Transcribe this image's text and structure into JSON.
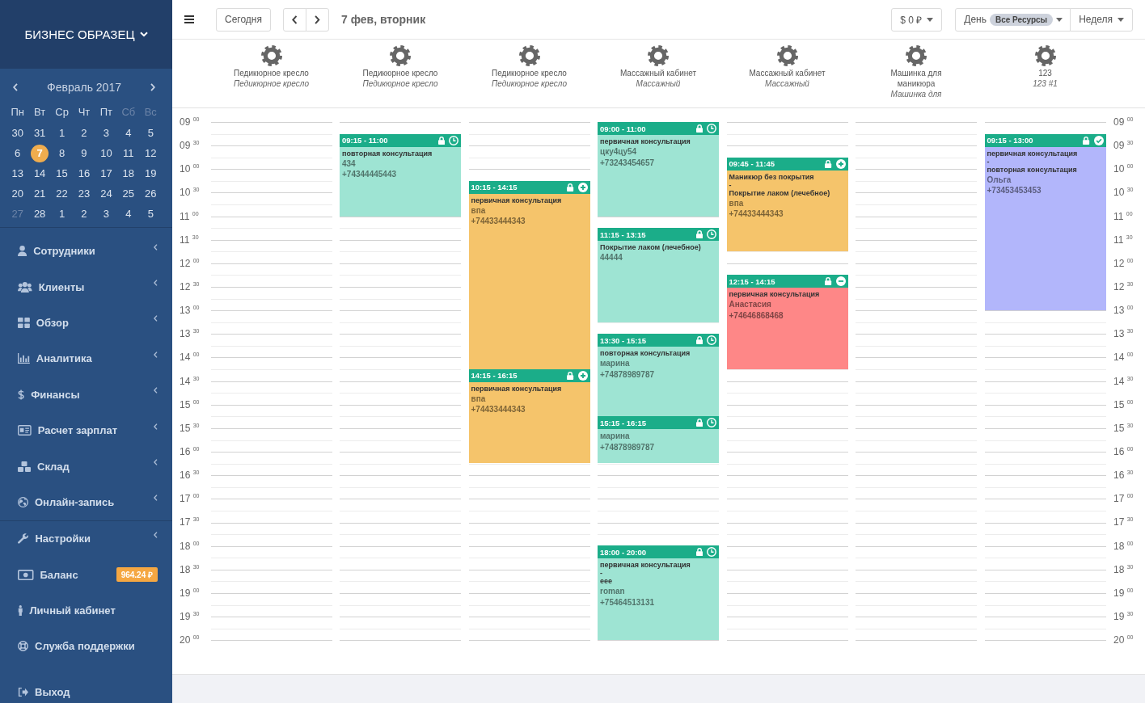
{
  "sidebar": {
    "title": "БИЗНЕС ОБРАЗЕЦ",
    "calendar": {
      "month": "Февраль 2017",
      "weekdays": [
        {
          "label": "Пн",
          "weekend": false
        },
        {
          "label": "Вт",
          "weekend": false
        },
        {
          "label": "Ср",
          "weekend": false
        },
        {
          "label": "Чт",
          "weekend": false
        },
        {
          "label": "Пт",
          "weekend": false
        },
        {
          "label": "Сб",
          "weekend": true
        },
        {
          "label": "Вс",
          "weekend": true
        }
      ],
      "days": [
        {
          "label": "30",
          "selected": false,
          "dimmed": false
        },
        {
          "label": "31",
          "selected": false,
          "dimmed": false
        },
        {
          "label": "1",
          "selected": false,
          "dimmed": false
        },
        {
          "label": "2",
          "selected": false,
          "dimmed": false
        },
        {
          "label": "3",
          "selected": false,
          "dimmed": false
        },
        {
          "label": "4",
          "selected": false,
          "dimmed": false
        },
        {
          "label": "5",
          "selected": false,
          "dimmed": false
        },
        {
          "label": "6",
          "selected": false,
          "dimmed": false
        },
        {
          "label": "7",
          "selected": true,
          "dimmed": false
        },
        {
          "label": "8",
          "selected": false,
          "dimmed": false
        },
        {
          "label": "9",
          "selected": false,
          "dimmed": false
        },
        {
          "label": "10",
          "selected": false,
          "dimmed": false
        },
        {
          "label": "11",
          "selected": false,
          "dimmed": false
        },
        {
          "label": "12",
          "selected": false,
          "dimmed": false
        },
        {
          "label": "13",
          "selected": false,
          "dimmed": false
        },
        {
          "label": "14",
          "selected": false,
          "dimmed": false
        },
        {
          "label": "15",
          "selected": false,
          "dimmed": false
        },
        {
          "label": "16",
          "selected": false,
          "dimmed": false
        },
        {
          "label": "17",
          "selected": false,
          "dimmed": false
        },
        {
          "label": "18",
          "selected": false,
          "dimmed": false
        },
        {
          "label": "19",
          "selected": false,
          "dimmed": false
        },
        {
          "label": "20",
          "selected": false,
          "dimmed": false
        },
        {
          "label": "21",
          "selected": false,
          "dimmed": false
        },
        {
          "label": "22",
          "selected": false,
          "dimmed": false
        },
        {
          "label": "23",
          "selected": false,
          "dimmed": false
        },
        {
          "label": "24",
          "selected": false,
          "dimmed": false
        },
        {
          "label": "25",
          "selected": false,
          "dimmed": false
        },
        {
          "label": "26",
          "selected": false,
          "dimmed": false
        },
        {
          "label": "27",
          "selected": false,
          "dimmed": true
        },
        {
          "label": "28",
          "selected": false,
          "dimmed": false
        },
        {
          "label": "1",
          "selected": false,
          "dimmed": false
        },
        {
          "label": "2",
          "selected": false,
          "dimmed": false
        },
        {
          "label": "3",
          "selected": false,
          "dimmed": false
        },
        {
          "label": "4",
          "selected": false,
          "dimmed": false
        },
        {
          "label": "5",
          "selected": false,
          "dimmed": false
        }
      ]
    },
    "menu_sections": [
      {
        "divider_above": true,
        "items": [
          {
            "label": "Сотрудники",
            "submenu": true
          },
          {
            "label": "Клиенты",
            "submenu": true
          },
          {
            "label": "Обзор",
            "submenu": true
          },
          {
            "label": "Аналитика",
            "submenu": true
          },
          {
            "label": "Финансы",
            "submenu": true
          },
          {
            "label": "Расчет зарплат",
            "submenu": true
          },
          {
            "label": "Склад",
            "submenu": true
          },
          {
            "label": "Онлайн-запись",
            "submenu": true
          }
        ]
      },
      {
        "divider_above": true,
        "items": [
          {
            "label": "Настройки",
            "submenu": true
          },
          {
            "label": "Баланс",
            "submenu": false,
            "badge": "964.24 ₽"
          },
          {
            "label": "Личный кабинет",
            "submenu": false
          },
          {
            "label": "Служба поддержки",
            "submenu": false
          }
        ]
      },
      {
        "divider_above": false,
        "items": [
          {
            "label": "Выход",
            "submenu": false
          }
        ]
      }
    ]
  },
  "toolbar": {
    "today": "Сегодня",
    "date": "7 фев, вторник",
    "currency": "$ 0 ₽",
    "day_view": "День",
    "resource_filter": "Все Ресурсы",
    "week_view": "Неделя"
  },
  "resources": [
    {
      "name": "Педикюрное кресло",
      "subtitle": "Педикюрное кресло"
    },
    {
      "name": "Педикюрное кресло",
      "subtitle": "Педикюрное кресло",
      "events": [
        {
          "time": "09:15 - 11:00",
          "locked": true,
          "kind": "clock",
          "color": "#9ee4d3",
          "lines": [
            {
              "kind": "service",
              "text": "повторная консультация"
            },
            {
              "kind": "client",
              "text": "434"
            },
            {
              "kind": "phone",
              "text": "+74344445443"
            }
          ]
        }
      ]
    },
    {
      "name": "Педикюрное кресло",
      "subtitle": "Педикюрное кресло",
      "events": [
        {
          "time": "10:15 - 14:15",
          "locked": true,
          "kind": "plus",
          "color": "#f5c46b",
          "lines": [
            {
              "kind": "service",
              "text": "первичная консультация"
            },
            {
              "kind": "client",
              "text": "впа"
            },
            {
              "kind": "phone",
              "text": "+74433444343"
            }
          ]
        },
        {
          "time": "14:15 - 16:15",
          "locked": true,
          "kind": "plus",
          "color": "#f5c46b",
          "lines": [
            {
              "kind": "service",
              "text": "первичная консультация"
            },
            {
              "kind": "client",
              "text": "впа"
            },
            {
              "kind": "phone",
              "text": "+74433444343"
            }
          ]
        }
      ]
    },
    {
      "name": "Массажный кабинет",
      "subtitle": "Массажный",
      "events": [
        {
          "time": "09:00 - 11:00",
          "locked": true,
          "kind": "clock",
          "color": "#9ee4d3",
          "lines": [
            {
              "kind": "service",
              "text": "первичная консультация"
            },
            {
              "kind": "client",
              "text": "цку4цу54"
            },
            {
              "kind": "phone",
              "text": "+73243454657"
            }
          ]
        },
        {
          "time": "11:15 - 13:15",
          "locked": true,
          "kind": "clock",
          "color": "#9ee4d3",
          "lines": [
            {
              "kind": "service",
              "text": "Покрытие лаком (лечебное)"
            },
            {
              "kind": "client",
              "text": "44444"
            }
          ]
        },
        {
          "time": "13:30 - 15:15",
          "locked": true,
          "kind": "clock",
          "color": "#9ee4d3",
          "lines": [
            {
              "kind": "service",
              "text": "повторная консультация"
            },
            {
              "kind": "client",
              "text": "марина"
            },
            {
              "kind": "phone",
              "text": "+74878989787"
            }
          ]
        },
        {
          "time": "15:15 - 16:15",
          "locked": true,
          "kind": "clock",
          "color": "#9ee4d3",
          "lines": [
            {
              "kind": "client",
              "text": "марина"
            },
            {
              "kind": "phone",
              "text": "+74878989787"
            }
          ]
        },
        {
          "time": "18:00 - 20:00",
          "locked": true,
          "kind": "clock",
          "color": "#9ee4d3",
          "lines": [
            {
              "kind": "service",
              "text": "первичная консультация"
            },
            {
              "kind": "separator",
              "text": "-"
            },
            {
              "kind": "service",
              "text": "eee"
            },
            {
              "kind": "client",
              "text": "roman"
            },
            {
              "kind": "phone",
              "text": "+75464513131"
            }
          ]
        }
      ]
    },
    {
      "name": "Массажный кабинет",
      "subtitle": "Массажный",
      "events": [
        {
          "time": "09:45 - 11:45",
          "locked": true,
          "kind": "plus",
          "color": "#f5c46b",
          "lines": [
            {
              "kind": "service",
              "text": "Маникюр без покрытия"
            },
            {
              "kind": "separator",
              "text": "-"
            },
            {
              "kind": "service",
              "text": "Покрытие лаком (лечебное)"
            },
            {
              "kind": "client",
              "text": "впа"
            },
            {
              "kind": "phone",
              "text": "+74433444343"
            }
          ]
        },
        {
          "time": "12:15 - 14:15",
          "locked": true,
          "kind": "minus",
          "color": "#fe8787",
          "lines": [
            {
              "kind": "service",
              "text": "первичная консультация"
            },
            {
              "kind": "client",
              "text": "Анастасия"
            },
            {
              "kind": "phone",
              "text": "+74646868468"
            }
          ]
        }
      ]
    },
    {
      "name": "Машинка для маникюра",
      "subtitle": "Машинка для"
    },
    {
      "name": "123",
      "subtitle": "123 #1",
      "events": [
        {
          "time": "09:15 - 13:00",
          "locked": true,
          "kind": "check",
          "color": "#b2b6fb",
          "lines": [
            {
              "kind": "service",
              "text": "первичная консультация"
            },
            {
              "kind": "separator",
              "text": "-"
            },
            {
              "kind": "service",
              "text": "повторная консультация"
            },
            {
              "kind": "client",
              "text": "Ольга"
            },
            {
              "kind": "phone",
              "text": "+73453453453"
            }
          ]
        }
      ]
    }
  ],
  "time_axis": {
    "left": [
      "09 $^{00}$",
      "09 $^{30}$",
      "10 $^{00}$",
      "10 $^{30}$",
      "11 $^{00}$",
      "11 $^{30}$",
      "12 $^{00}$",
      "12 $^{30}$",
      "13 $^{00}$",
      "13 $^{30}$",
      "14 $^{00}$",
      "14 $^{30}$",
      "15 $^{00}$",
      "15 $^{30}$",
      "16 $^{00}$",
      "16 $^{30}$",
      "17 $^{00}$",
      "17 $^{30}$",
      "18 $^{00}$",
      "18 $^{30}$",
      "19 $^{00}$",
      "19 $^{30}$",
      "20 $^{00}$"
    ],
    "right": [
      "09 $^{00}$",
      "09 $^{30}$",
      "10 $^{00}$",
      "10 $^{30}$",
      "11 $^{00}$",
      "11 $^{30}$",
      "12 $^{00}$",
      "12 $^{30}$",
      "13 $^{00}$",
      "13 $^{30}$",
      "14 $^{00}$",
      "14 $^{30}$",
      "15 $^{00}$",
      "15 $^{30}$",
      "16 $^{00}$",
      "16 $^{30}$",
      "17 $^{00}$",
      "17 $^{30}$",
      "18 $^{00}$",
      "18 $^{30}$",
      "19 $^{00}$",
      "19 $^{30}$",
      "20 $^{00}$"
    ]
  }
}
